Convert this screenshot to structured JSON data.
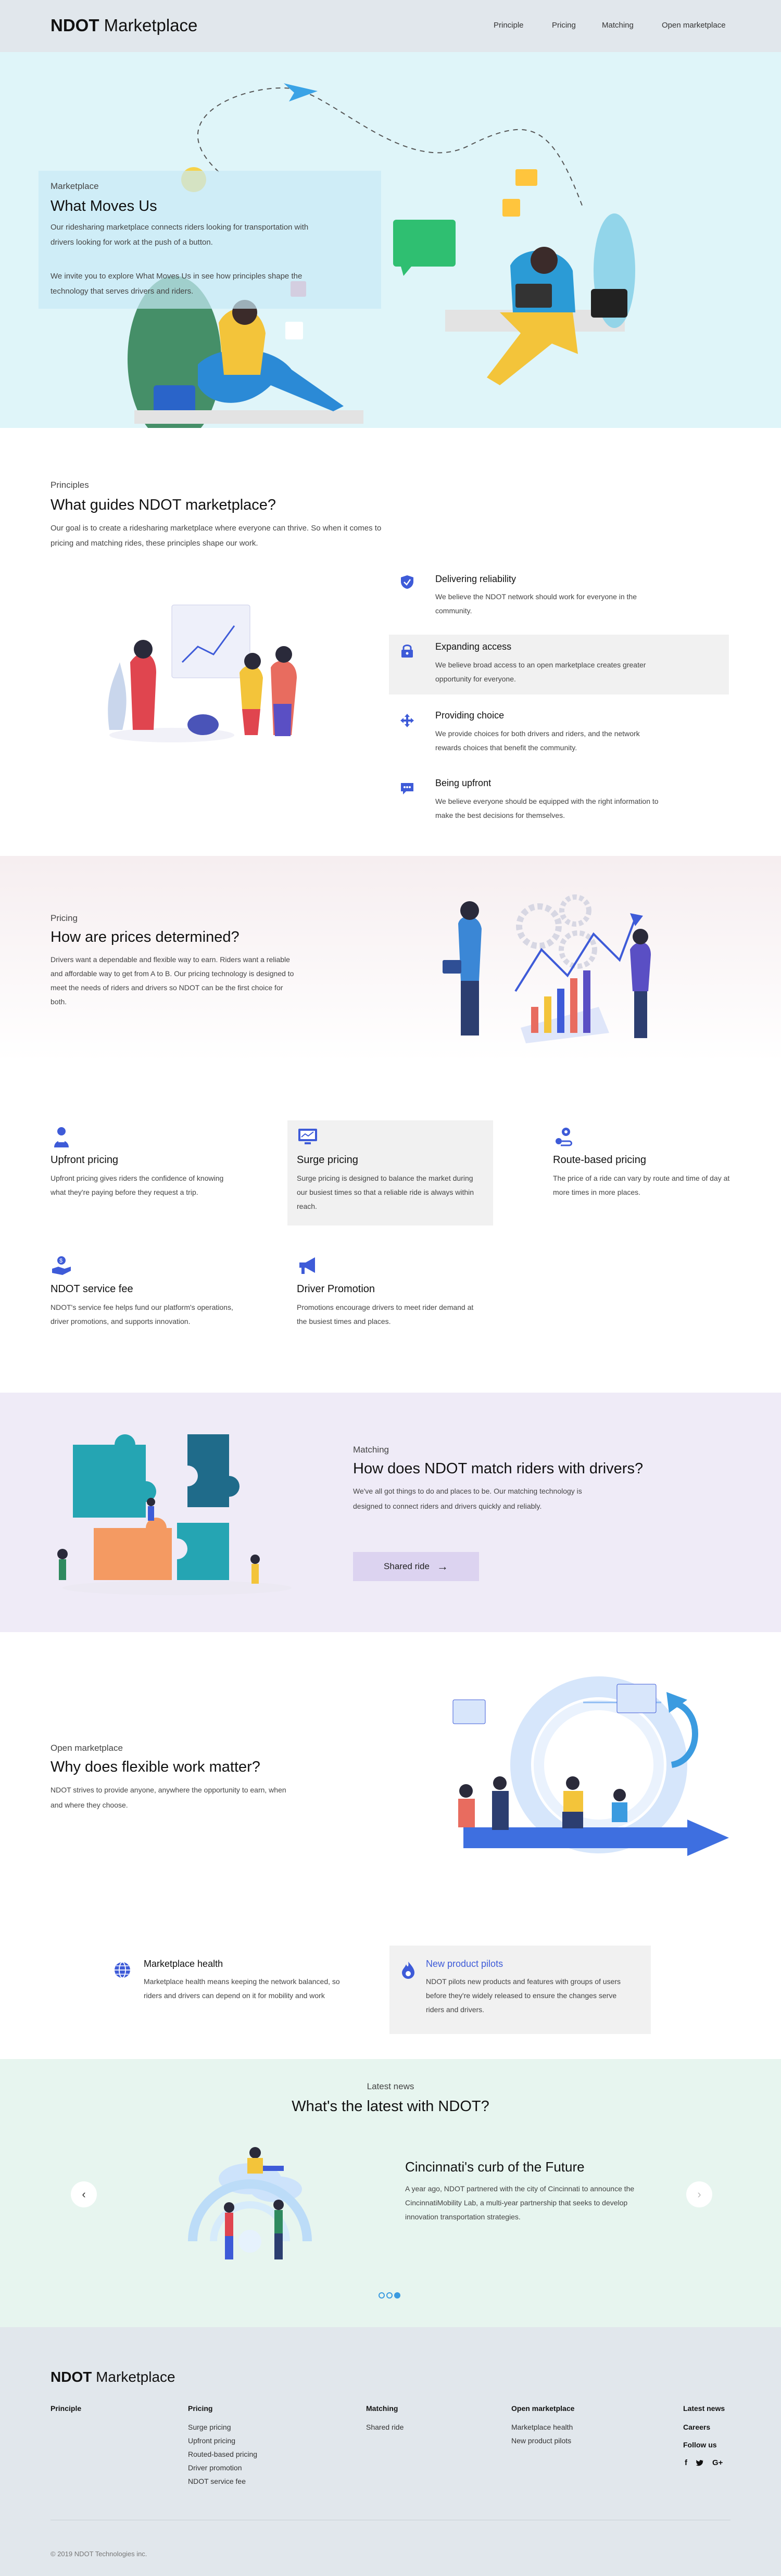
{
  "header": {
    "brand_bold": "NDOT",
    "brand_rest": " Marketplace",
    "nav": [
      "Principle",
      "Pricing",
      "Matching",
      "Open marketplace"
    ]
  },
  "hero": {
    "eyebrow": "Marketplace",
    "title": "What Moves Us",
    "p1": "Our ridesharing marketplace connects riders looking for transportation with drivers looking for work at the push of a button.",
    "p2": "We invite you to explore What Moves Us in see how principles shape the technology that serves drivers and riders."
  },
  "principles": {
    "eyebrow": "Principles",
    "title": "What guides NDOT marketplace?",
    "body": "Our goal is to create a ridesharing marketplace where everyone can thrive. So when it comes to pricing and matching rides, these principles shape our work.",
    "items": [
      {
        "title": "Delivering reliability",
        "body": "We believe the NDOT network should work for everyone in the community.",
        "icon": "shield-check-icon"
      },
      {
        "title": "Expanding access",
        "body": "We believe broad access to an open marketplace creates greater opportunity for everyone.",
        "icon": "lock-icon"
      },
      {
        "title": "Providing choice",
        "body": "We provide choices for both drivers and riders, and the network rewards choices that benefit the community.",
        "icon": "arrows-move-icon"
      },
      {
        "title": "Being upfront",
        "body": "We believe everyone should be equipped with the right information to make the best decisions for themselves.",
        "icon": "chat-icon"
      }
    ]
  },
  "pricing": {
    "eyebrow": "Pricing",
    "title": "How are prices determined?",
    "body": "Drivers want a dependable and flexible way to earn. Riders want a reliable and affordable way to get from A to B. Our pricing technology is designed to meet the needs of riders and drivers so NDOT can be the first choice for both.",
    "cards": [
      {
        "title": "Upfront pricing",
        "body": "Upfront pricing gives riders the confidence of knowing what they're paying before they request a trip.",
        "icon": "person-icon"
      },
      {
        "title": "Surge pricing",
        "body": "Surge pricing is designed to balance the market during our busiest times so that a reliable ride is always within reach.",
        "icon": "monitor-icon"
      },
      {
        "title": "Route-based pricing",
        "body": "The price of a ride can vary by route and time of day at more times in more places.",
        "icon": "route-icon"
      },
      {
        "title": "NDOT service fee",
        "body": "NDOT's service fee helps fund our platform's operations, driver promotions, and supports innovation.",
        "icon": "hand-coin-icon"
      },
      {
        "title": "Driver Promotion",
        "body": "Promotions encourage drivers to meet rider demand at the busiest times and places.",
        "icon": "megaphone-icon"
      }
    ]
  },
  "matching": {
    "eyebrow": "Matching",
    "title": "How does NDOT match riders with drivers?",
    "body": "We've all got things to do and places to be. Our matching technology is designed to connect riders and drivers quickly and reliably.",
    "button": "Shared ride"
  },
  "open": {
    "eyebrow": "Open marketplace",
    "title": "Why does flexible work matter?",
    "body": "NDOT strives to provide anyone, anywhere the opportunity to earn, when and where they choose.",
    "cards": [
      {
        "title": "Marketplace health",
        "body": "Marketplace health means keeping the network balanced, so riders and drivers can depend on it for mobility and work",
        "icon": "globe-icon"
      },
      {
        "title": "New product pilots",
        "body": "NDOT pilots new products and features with groups of users before they're widely released to ensure the changes serve riders and drivers.",
        "icon": "flame-icon"
      }
    ]
  },
  "news": {
    "eyebrow": "Latest news",
    "title": "What's the latest with NDOT?",
    "item_title": "Cincinnati's curb of the Future",
    "item_body": "A year ago, NDOT partnered with the city of Cincinnati to announce the CincinnatiMobility Lab, a multi-year partnership that seeks to develop innovation transportation strategies."
  },
  "footer": {
    "brand_bold": "NDOT",
    "brand_rest": " Marketplace",
    "cols": [
      {
        "head": "Principle",
        "links": []
      },
      {
        "head": "Pricing",
        "links": [
          "Surge pricing",
          "Upfront pricing",
          "Routed-based pricing",
          "Driver promotion",
          "NDOT service fee"
        ]
      },
      {
        "head": "Matching",
        "links": [
          "Shared ride"
        ]
      },
      {
        "head": "Open marketplace",
        "links": [
          "Marketplace health",
          "New product pilots"
        ]
      }
    ],
    "side": [
      "Latest news",
      "Careers",
      "Follow us"
    ],
    "social": [
      "f",
      "t",
      "G+"
    ],
    "copyright": "© 2019 NDOT Technologies inc."
  },
  "colors": {
    "accent": "#3e5bd8",
    "hero_bg": "#dff5f9",
    "pricing_bg": "#f6eef0",
    "matching_bg": "#efebf7",
    "news_bg": "#e7f5ef",
    "footer_bg": "#e1e7ec"
  }
}
